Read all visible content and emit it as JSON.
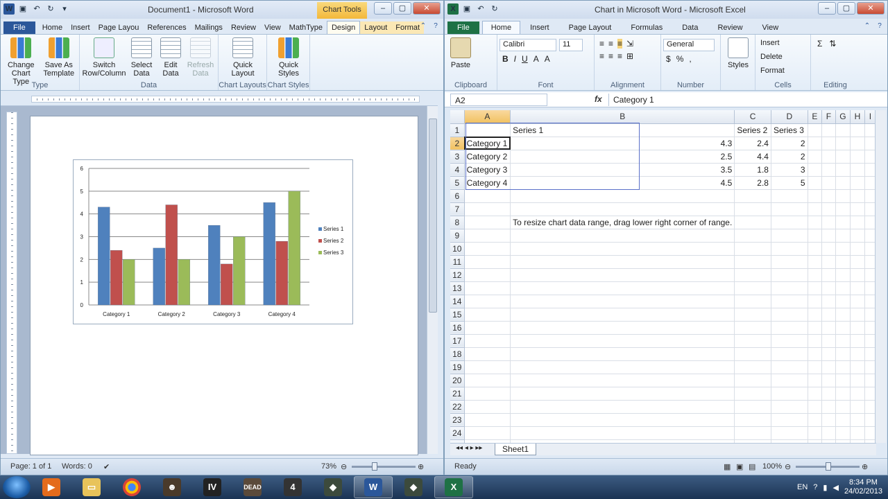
{
  "word": {
    "title": "Document1 - Microsoft Word",
    "contextual_tab": "Chart Tools",
    "tabs": [
      "File",
      "Home",
      "Insert",
      "Page Layou",
      "References",
      "Mailings",
      "Review",
      "View",
      "MathType",
      "Design",
      "Layout",
      "Format"
    ],
    "ribbon": {
      "type_group": {
        "label": "Type",
        "buttons": [
          "Change Chart Type",
          "Save As Template"
        ]
      },
      "data_group": {
        "label": "Data",
        "buttons": [
          "Switch Row/Column",
          "Select Data",
          "Edit Data",
          "Refresh Data"
        ]
      },
      "layouts_group": {
        "label": "Chart Layouts",
        "button": "Quick Layout"
      },
      "styles_group": {
        "label": "Chart Styles",
        "button": "Quick Styles"
      }
    },
    "status": {
      "page": "Page: 1 of 1",
      "words": "Words: 0",
      "zoom": "73%"
    },
    "chart_data": {
      "type": "bar",
      "categories": [
        "Category 1",
        "Category 2",
        "Category 3",
        "Category 4"
      ],
      "series": [
        {
          "name": "Series 1",
          "values": [
            4.3,
            2.5,
            3.5,
            4.5
          ],
          "color": "#4f81bd"
        },
        {
          "name": "Series 2",
          "values": [
            2.4,
            4.4,
            1.8,
            2.8
          ],
          "color": "#c0504d"
        },
        {
          "name": "Series 3",
          "values": [
            2,
            2,
            3,
            5
          ],
          "color": "#9bbb59"
        }
      ],
      "ylim": [
        0,
        6
      ],
      "yticks": [
        "0",
        "1",
        "2",
        "3",
        "4",
        "5",
        "6"
      ],
      "legend": "right",
      "grid": true
    }
  },
  "excel": {
    "title": "Chart in Microsoft Word - Microsoft Excel",
    "tabs": [
      "File",
      "Home",
      "Insert",
      "Page Layout",
      "Formulas",
      "Data",
      "Review",
      "View"
    ],
    "ribbon": {
      "clipboard": {
        "label": "Clipboard",
        "paste": "Paste"
      },
      "font": {
        "label": "Font",
        "name": "Calibri",
        "size": "11"
      },
      "alignment": {
        "label": "Alignment"
      },
      "number": {
        "label": "Number",
        "format": "General"
      },
      "styles": {
        "label": "Styles",
        "button": "Styles"
      },
      "cells": {
        "label": "Cells",
        "insert": "Insert",
        "delete": "Delete",
        "format": "Format"
      },
      "editing": {
        "label": "Editing"
      }
    },
    "name_box": "A2",
    "formula": "Category 1",
    "columns": [
      "A",
      "B",
      "C",
      "D",
      "E",
      "F",
      "G",
      "H",
      "I"
    ],
    "rows": [
      [
        "",
        "Series 1",
        "Series 2",
        "Series 3"
      ],
      [
        "Category 1",
        "4.3",
        "2.4",
        "2"
      ],
      [
        "Category 2",
        "2.5",
        "4.4",
        "2"
      ],
      [
        "Category 3",
        "3.5",
        "1.8",
        "3"
      ],
      [
        "Category 4",
        "4.5",
        "2.8",
        "5"
      ]
    ],
    "note": "To resize chart data range, drag lower right corner of range.",
    "sheet_tab": "Sheet1",
    "status": {
      "ready": "Ready",
      "zoom": "100%"
    }
  },
  "taskbar": {
    "lang": "EN",
    "time": "8:34 PM",
    "date": "24/02/2013"
  }
}
